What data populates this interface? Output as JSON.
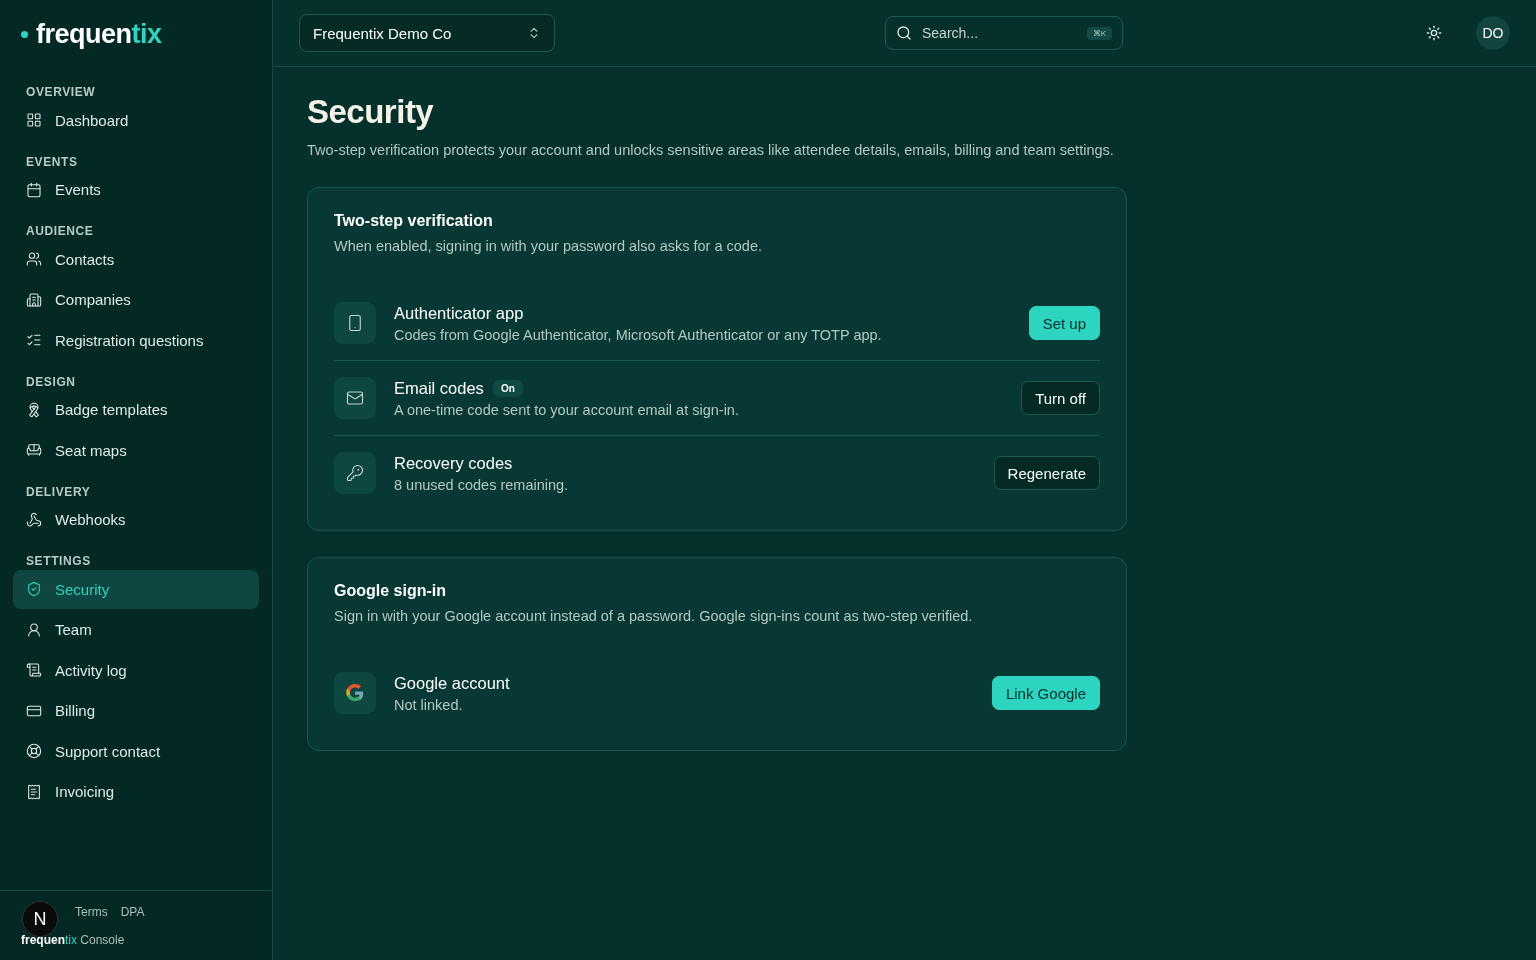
{
  "brand": {
    "name": "frequen",
    "accent": "tix"
  },
  "sidebar": {
    "sections": [
      {
        "title": "OVERVIEW",
        "items": [
          {
            "label": "Dashboard",
            "selected": false
          }
        ]
      },
      {
        "title": "EVENTS",
        "items": [
          {
            "label": "Events",
            "selected": false
          }
        ]
      },
      {
        "title": "AUDIENCE",
        "items": [
          {
            "label": "Contacts",
            "selected": false
          },
          {
            "label": "Companies",
            "selected": false
          },
          {
            "label": "Registration questions",
            "selected": false
          }
        ]
      },
      {
        "title": "DESIGN",
        "items": [
          {
            "label": "Badge templates",
            "selected": false
          },
          {
            "label": "Seat maps",
            "selected": false
          }
        ]
      },
      {
        "title": "DELIVERY",
        "items": [
          {
            "label": "Webhooks",
            "selected": false
          }
        ]
      },
      {
        "title": "SETTINGS",
        "items": [
          {
            "label": "Security",
            "selected": true
          },
          {
            "label": "Team",
            "selected": false
          },
          {
            "label": "Activity log",
            "selected": false
          },
          {
            "label": "Billing",
            "selected": false
          },
          {
            "label": "Support contact",
            "selected": false
          },
          {
            "label": "Invoicing",
            "selected": false
          }
        ]
      }
    ]
  },
  "footer": {
    "links": [
      "Terms",
      "DPA"
    ],
    "brand": {
      "name": "frequen",
      "accent": "tix",
      "suffix": "Console"
    },
    "dev_badge": "N"
  },
  "topbar": {
    "org": "Frequentix Demo Co",
    "search": {
      "placeholder": "Search...",
      "shortcut": "⌘K"
    },
    "avatar": "DO"
  },
  "page": {
    "title": "Security",
    "description": "Two-step verification protects your account and unlocks sensitive areas like attendee details, emails, billing and team settings."
  },
  "cards": [
    {
      "title": "Two-step verification",
      "description": "When enabled, signing in with your password also asks for a code.",
      "rows": [
        {
          "kind": "phone",
          "title": "Authenticator app",
          "detail": "Codes from Google Authenticator, Microsoft Authenticator or any TOTP app.",
          "button": {
            "label": "Set up",
            "kind": "primary"
          }
        },
        {
          "kind": "mail",
          "title": "Email codes",
          "badge": "On",
          "detail": "A one-time code sent to your account email at sign-in.",
          "button": {
            "label": "Turn off",
            "kind": "secondary"
          }
        },
        {
          "kind": "key",
          "title": "Recovery codes",
          "detail": "8 unused codes remaining.",
          "button": {
            "label": "Regenerate",
            "kind": "secondary"
          }
        }
      ]
    },
    {
      "title": "Google sign-in",
      "description": "Sign in with your Google account instead of a password. Google sign-ins count as two-step verified.",
      "rows": [
        {
          "kind": "google",
          "title": "Google account",
          "detail": "Not linked.",
          "button": {
            "label": "Link Google",
            "kind": "primary"
          }
        }
      ]
    }
  ]
}
